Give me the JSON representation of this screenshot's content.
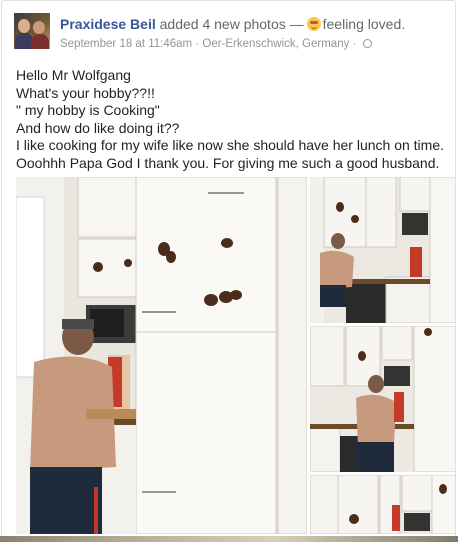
{
  "post": {
    "author": "Praxidese Beil",
    "action": "added 4 new photos —",
    "feeling": "feeling loved.",
    "date": "September 18 at 11:46am",
    "separator": "·",
    "location": "Oer-Erkenschwick, Germany",
    "separator2": "·",
    "icons": {
      "feeling": "smiling-face-emoji-icon",
      "privacy": "globe-icon"
    }
  },
  "text_lines": [
    "Hello Mr Wolfgang",
    "What's your hobby??!!",
    "\" my hobby is Cooking\"",
    "And how do like doing it??",
    "I like cooking for my wife like now she should have her lunch on time.",
    "Ooohhh Papa God I thank you. For giving me such a good husband."
  ],
  "photos": {
    "count": 4,
    "descriptions_hidden": true
  },
  "colors": {
    "link": "#365899",
    "text": "#1d2129",
    "meta": "#90949c",
    "border": "#dddfe2"
  }
}
